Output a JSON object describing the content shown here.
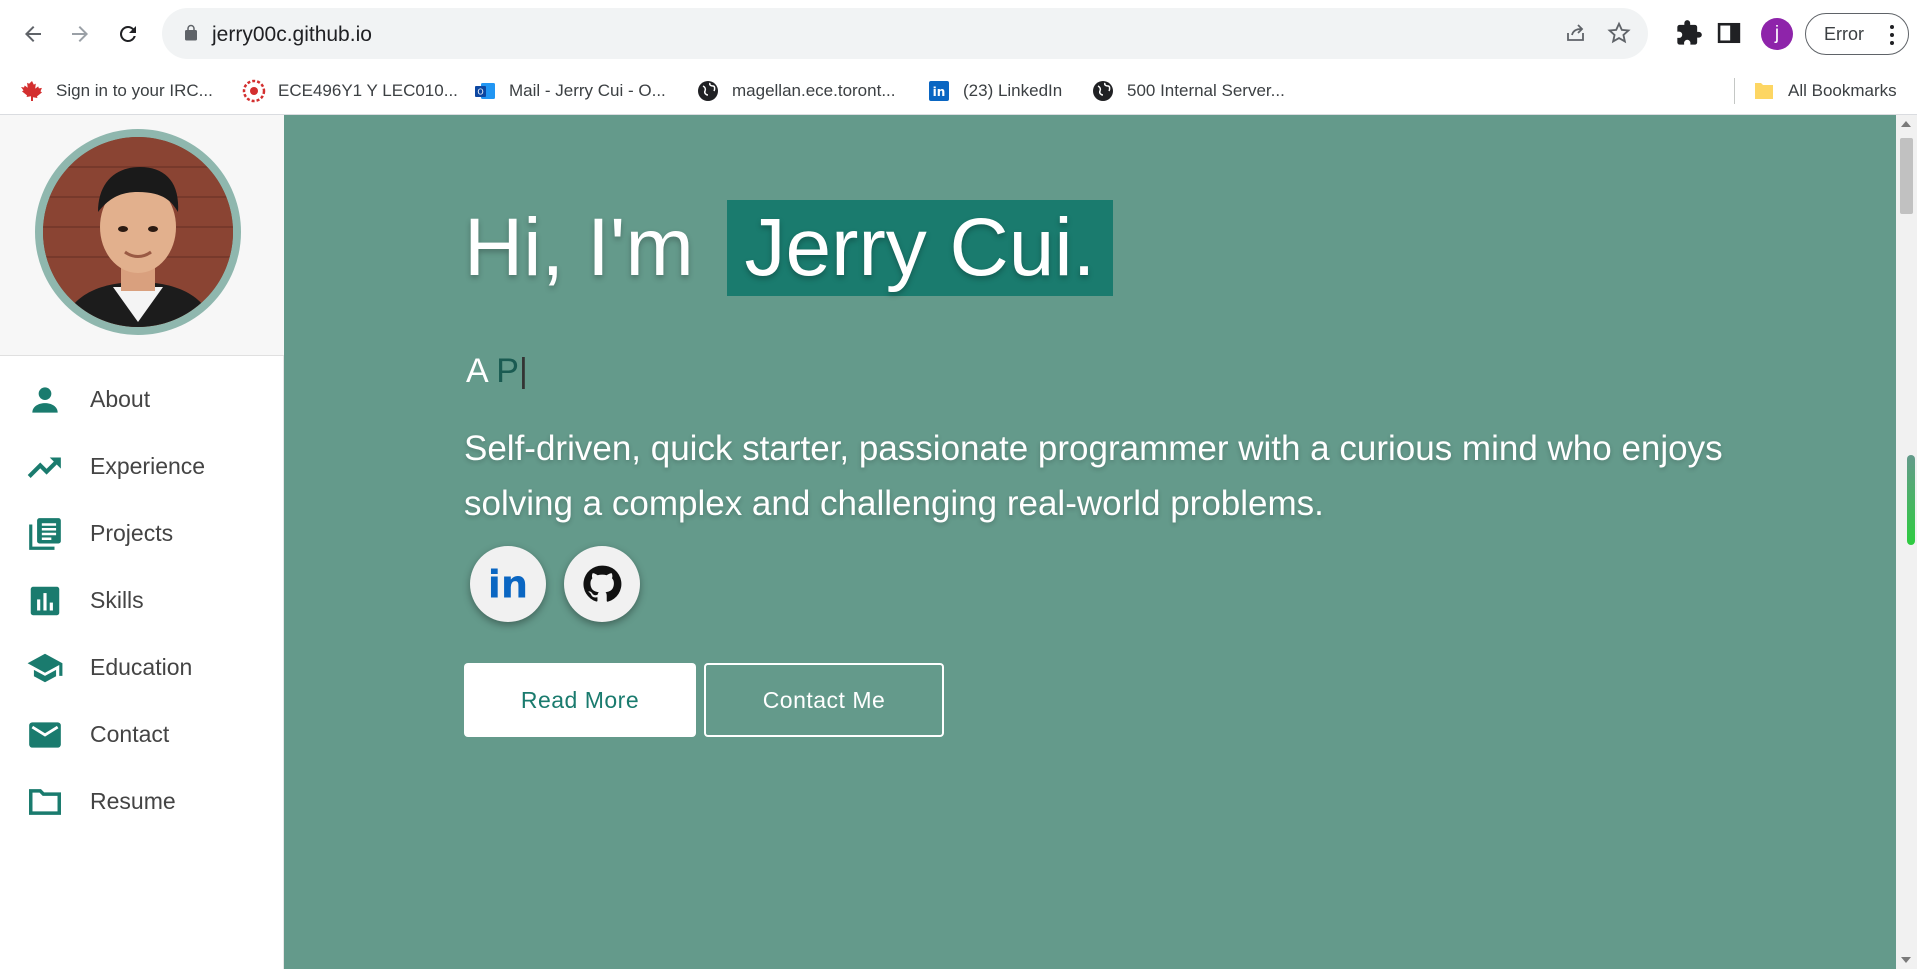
{
  "browser": {
    "url": "jerry00c.github.io",
    "profile_initial": "j",
    "error_label": "Error",
    "bookmarks": [
      {
        "label": "Sign in to your IRC..."
      },
      {
        "label": "ECE496Y1 Y LEC010..."
      },
      {
        "label": "Mail - Jerry Cui - O..."
      },
      {
        "label": "magellan.ece.toront..."
      },
      {
        "label": "(23) LinkedIn"
      },
      {
        "label": "500 Internal Server..."
      }
    ],
    "all_bookmarks_label": "All Bookmarks"
  },
  "sidebar": {
    "items": [
      {
        "label": "About",
        "icon": "person-icon"
      },
      {
        "label": "Experience",
        "icon": "trending-up-icon"
      },
      {
        "label": "Projects",
        "icon": "library-books-icon"
      },
      {
        "label": "Skills",
        "icon": "bar-chart-icon"
      },
      {
        "label": "Education",
        "icon": "school-icon"
      },
      {
        "label": "Contact",
        "icon": "email-icon"
      },
      {
        "label": "Resume",
        "icon": "folder-icon"
      }
    ]
  },
  "hero": {
    "greeting_prefix": "Hi, I'm",
    "name": "Jerry Cui.",
    "typed_prefix": "A",
    "typed_partial": "P",
    "typed_cursor": "|",
    "bio": "Self-driven, quick starter, passionate programmer with a curious mind who enjoys solving a complex and challenging real-world problems.",
    "read_more": "Read More",
    "contact_me": "Contact Me"
  },
  "colors": {
    "accent": "#1a7b6e",
    "hero_bg": "#649a8b",
    "icon": "#1a7b6e"
  }
}
